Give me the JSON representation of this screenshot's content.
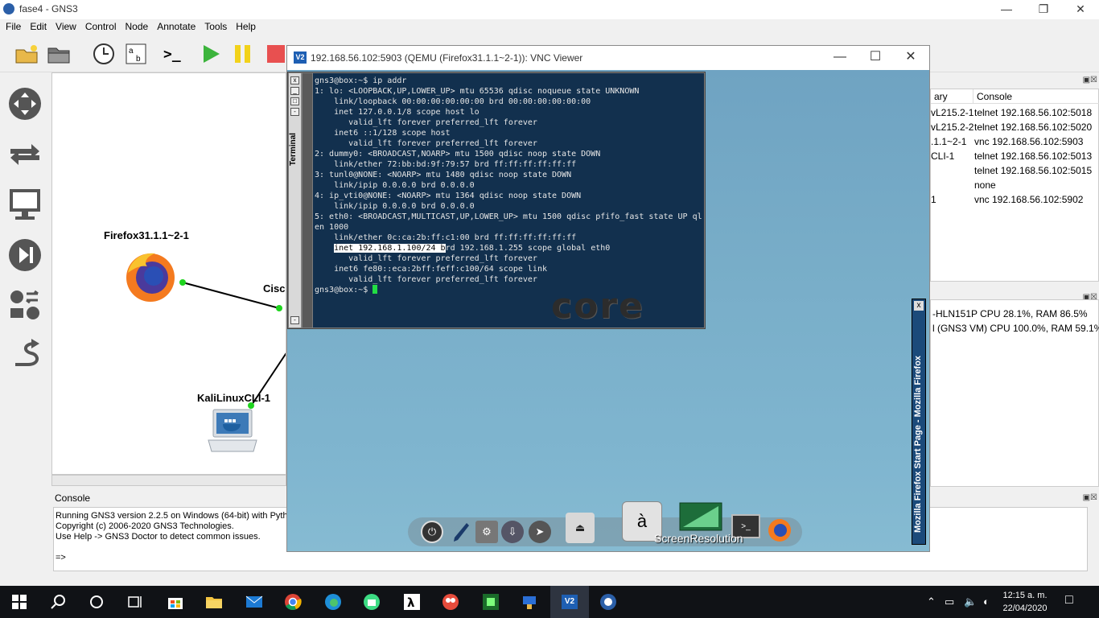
{
  "gns3": {
    "title": "fase4 - GNS3",
    "menu": [
      "File",
      "Edit",
      "View",
      "Control",
      "Node",
      "Annotate",
      "Tools",
      "Help"
    ],
    "nodes": {
      "firefox": "Firefox31.1.1~2-1",
      "cisco": "Cisco",
      "kali": "KaliLinuxCLI-1"
    },
    "summary": {
      "partial_header": "ary",
      "console_header": "Console",
      "rows": [
        {
          "name": "vL215.2-1",
          "console": "telnet 192.168.56.102:5018"
        },
        {
          "name": "vL215.2-2",
          "console": "telnet 192.168.56.102:5020"
        },
        {
          "name": ".1.1~2-1",
          "console": "vnc 192.168.56.102:5903"
        },
        {
          "name": "CLI-1",
          "console": "telnet 192.168.56.102:5013"
        },
        {
          "name": "",
          "console": "telnet 192.168.56.102:5015"
        },
        {
          "name": "",
          "console": "none"
        },
        {
          "name": "1",
          "console": "vnc 192.168.56.102:5902"
        }
      ]
    },
    "resources": [
      "-HLN151P CPU 28.1%, RAM 86.5%",
      "l (GNS3 VM) CPU 100.0%, RAM 59.1%"
    ],
    "console": {
      "title": "Console",
      "lines": [
        "Running GNS3 version 2.2.5 on Windows (64-bit) with Pytho",
        "Copyright (c) 2006-2020 GNS3 Technologies.",
        "Use Help -> GNS3 Doctor to detect common issues.",
        "",
        "=>"
      ]
    }
  },
  "vnc": {
    "logo": "V2",
    "title": "192.168.56.102:5903 (QEMU (Firefox31.1.1~2-1)): VNC Viewer",
    "terminal_tab": "Terminal",
    "terminal_lines": [
      "gns3@box:~$ ip addr",
      "1: lo: <LOOPBACK,UP,LOWER_UP> mtu 65536 qdisc noqueue state UNKNOWN",
      "    link/loopback 00:00:00:00:00:00 brd 00:00:00:00:00:00",
      "    inet 127.0.0.1/8 scope host lo",
      "       valid_lft forever preferred_lft forever",
      "    inet6 ::1/128 scope host",
      "       valid_lft forever preferred_lft forever",
      "2: dummy0: <BROADCAST,NOARP> mtu 1500 qdisc noop state DOWN",
      "    link/ether 72:bb:bd:9f:79:57 brd ff:ff:ff:ff:ff:ff",
      "3: tunl0@NONE: <NOARP> mtu 1480 qdisc noop state DOWN",
      "    link/ipip 0.0.0.0 brd 0.0.0.0",
      "4: ip_vti0@NONE: <NOARP> mtu 1364 qdisc noop state DOWN",
      "    link/ipip 0.0.0.0 brd 0.0.0.0",
      "5: eth0: <BROADCAST,MULTICAST,UP,LOWER_UP> mtu 1500 qdisc pfifo_fast state UP ql",
      "en 1000",
      "    link/ether 0c:ca:2b:ff:c1:00 brd ff:ff:ff:ff:ff:ff"
    ],
    "inet_selected": "inet 192.168.1.100/24 b",
    "inet_rest": "rd 192.168.1.255 scope global eth0",
    "terminal_lines_after": [
      "       valid_lft forever preferred_lft forever",
      "    inet6 fe80::eca:2bff:feff:c100/64 scope link",
      "       valid_lft forever preferred_lft forever"
    ],
    "prompt": "gns3@box:~$ ",
    "core_logo": "core",
    "firefox_panel": "Mozilla Firefox Start Page - Mozilla Firefox",
    "dock_label": "ScreenResolution",
    "dock_a_char": "à"
  },
  "taskbar": {
    "time": "12:15 a. m.",
    "date": "22/04/2020",
    "vnc_logo": "V2"
  }
}
